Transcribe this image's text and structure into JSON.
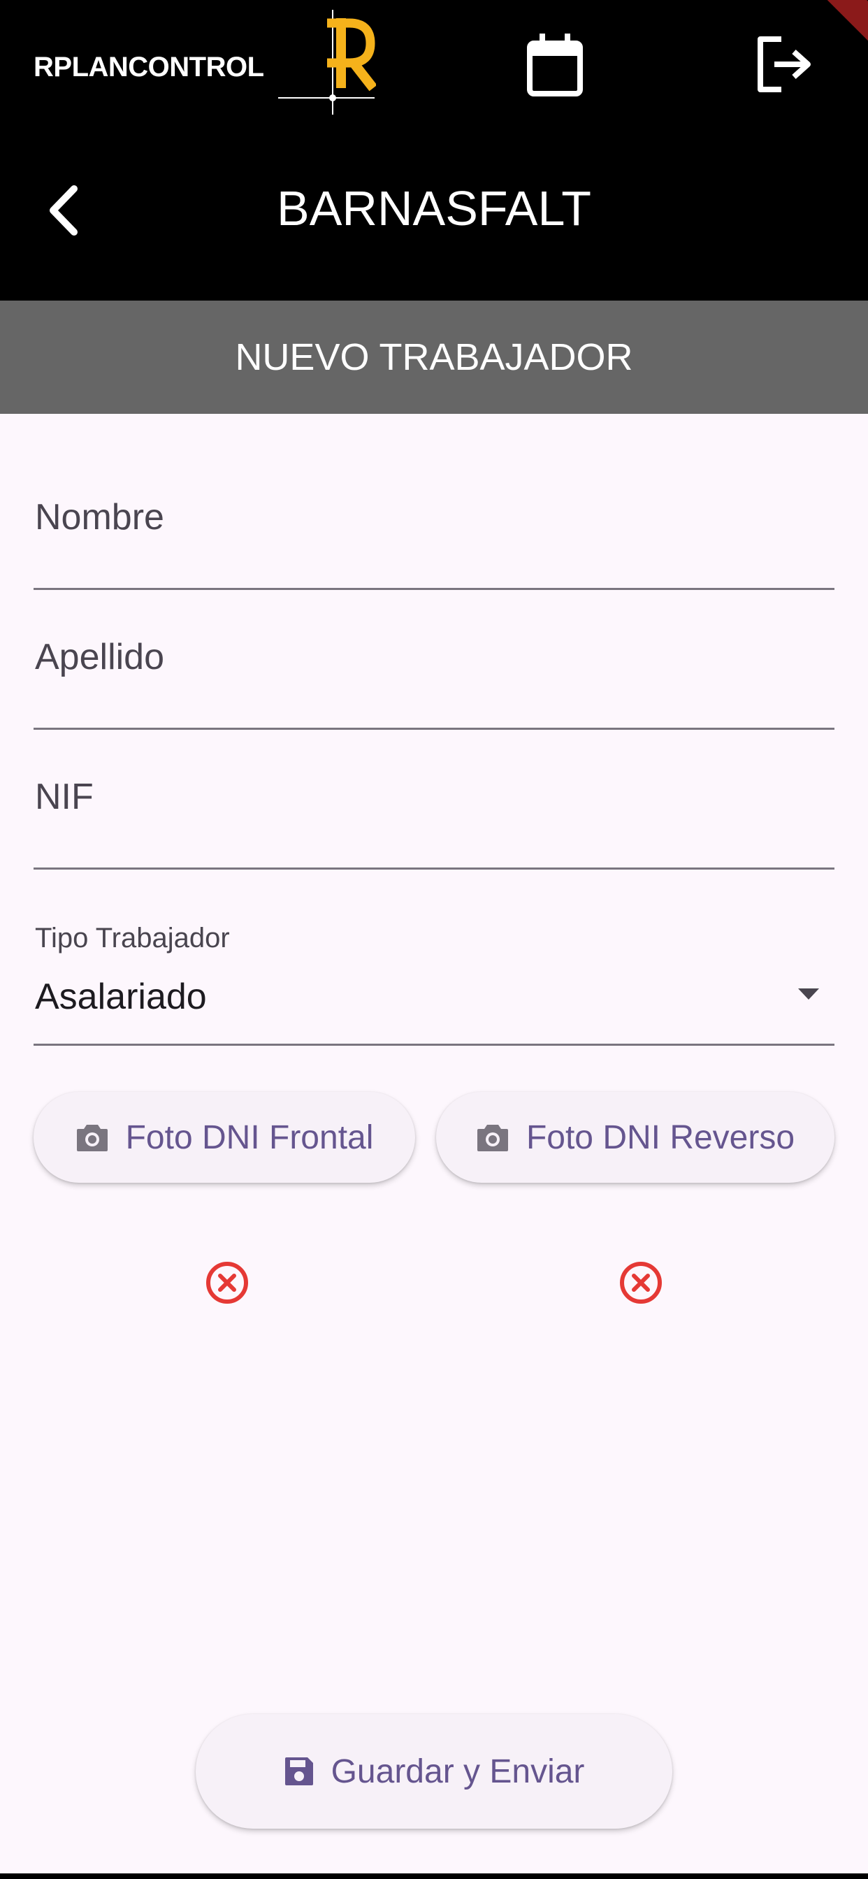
{
  "header": {
    "logo_text": "RPLANCONTROL",
    "logo_letter": "R",
    "company": "BARNASFALT",
    "icons": {
      "calendar": "calendar-icon",
      "logout": "logout-icon",
      "back": "chevron-left-icon"
    }
  },
  "section": {
    "title": "NUEVO TRABAJADOR"
  },
  "form": {
    "nombre_placeholder": "Nombre",
    "apellido_placeholder": "Apellido",
    "nif_placeholder": "NIF",
    "tipo_label": "Tipo Trabajador",
    "tipo_value": "Asalariado"
  },
  "photo_buttons": {
    "frontal_label": "Foto DNI Frontal",
    "reverso_label": "Foto DNI Reverso"
  },
  "actions": {
    "save_label": "Guardar y Enviar"
  },
  "colors": {
    "header_bg": "#000000",
    "band_bg": "#666666",
    "page_bg": "#FDF7FD",
    "accent": "#65558F",
    "logo_accent": "#F5B21B",
    "error": "#E53935"
  }
}
